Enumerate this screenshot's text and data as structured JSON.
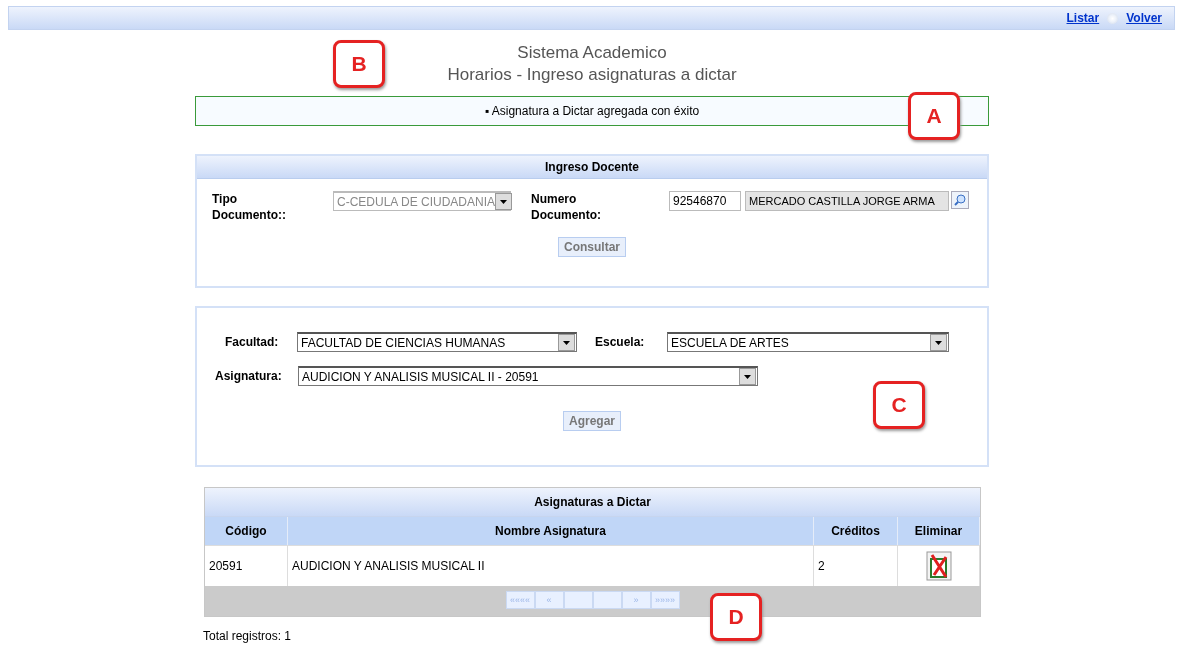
{
  "top_bar": {
    "links": [
      "Listar",
      "Volver"
    ]
  },
  "header": {
    "title": "Sistema Academico",
    "subtitle": "Horarios - Ingreso asignaturas a dictar"
  },
  "message": {
    "bullet": "▪",
    "text": "Asignatura a Dictar agregada con éxito"
  },
  "docente_panel": {
    "title": "Ingreso Docente",
    "tipo_label": "Tipo Documento::",
    "tipo_value": "C-CEDULA DE CIUDADANIA",
    "tipo_disabled": true,
    "numero_label": "Numero Documento:",
    "numero_value": "92546870",
    "nombre_value": "MERCADO CASTILLA JORGE ARMA",
    "button": "Consultar"
  },
  "asignatura_panel": {
    "facultad_label": "Facultad:",
    "facultad_value": "FACULTAD DE CIENCIAS HUMANAS",
    "escuela_label": "Escuela:",
    "escuela_value": "ESCUELA DE ARTES",
    "asignatura_label": "Asignatura:",
    "asignatura_value": "AUDICION Y ANALISIS MUSICAL II - 20591",
    "button": "Agregar"
  },
  "table": {
    "title": "Asignaturas a Dictar",
    "columns": [
      "Código",
      "Nombre Asignatura",
      "Créditos",
      "Eliminar"
    ],
    "rows": [
      {
        "codigo": "20591",
        "nombre": "AUDICION Y ANALISIS MUSICAL II",
        "creditos": "2"
      }
    ],
    "pager": [
      "««««",
      "«",
      "»",
      "»»»»"
    ]
  },
  "total": "Total registros: 1",
  "callouts": [
    {
      "label": "B"
    },
    {
      "label": "A"
    },
    {
      "label": "C"
    },
    {
      "label": "D"
    }
  ]
}
